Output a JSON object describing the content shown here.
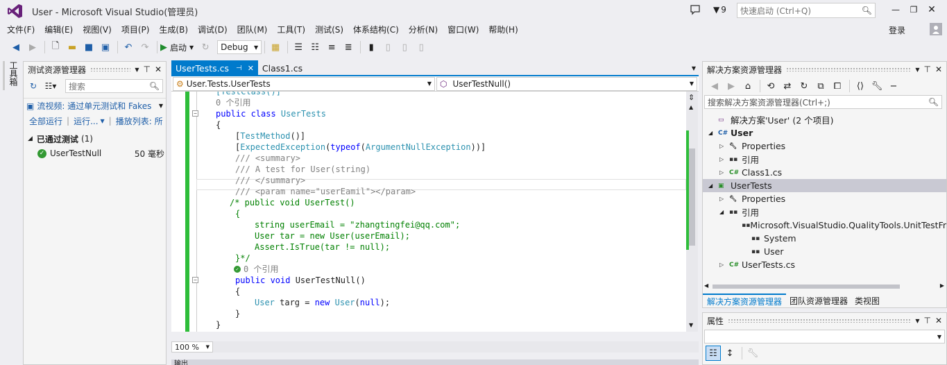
{
  "window": {
    "title": "User - Microsoft Visual Studio(管理员)",
    "notifications": "9",
    "quick_launch_placeholder": "快速启动 (Ctrl+Q)",
    "login": "登录"
  },
  "menu": [
    "文件(F)",
    "编辑(E)",
    "视图(V)",
    "项目(P)",
    "生成(B)",
    "调试(D)",
    "团队(M)",
    "工具(T)",
    "测试(S)",
    "体系结构(C)",
    "分析(N)",
    "窗口(W)",
    "帮助(H)"
  ],
  "toolbar": {
    "start_label": "启动",
    "config": "Debug"
  },
  "toolbox_tab": "工具箱",
  "test_explorer": {
    "title": "测试资源管理器",
    "search_placeholder": "搜索",
    "video_link": "流视频: 通过单元测试和 Fakes",
    "run_all": "全部运行",
    "run": "运行...",
    "playlist": "播放列表: 所",
    "group_label": "已通过测试",
    "group_count": "(1)",
    "tests": [
      {
        "name": "UserTestNull",
        "duration": "50 毫秒"
      }
    ]
  },
  "editor": {
    "tabs": [
      {
        "label": "UserTests.cs",
        "pin": "⊣",
        "active": true
      },
      {
        "label": "Class1.cs",
        "active": false
      }
    ],
    "nav_class": "User.Tests.UserTests",
    "nav_member": "UserTestNull()",
    "zoom": "100 %",
    "lines": [
      {
        "t": "[TestClass()]"
      },
      {
        "t": "0 个引用"
      },
      {
        "t": "public class UserTests"
      },
      {
        "t": "{"
      },
      {
        "t": "[TestMethod()]"
      },
      {
        "t": "[ExpectedException(typeof(ArgumentNullException))]"
      },
      {
        "t": "/// <summary>"
      },
      {
        "t": "/// A test for User(string)"
      },
      {
        "t": "/// </summary>"
      },
      {
        "t": "/// <param name=\"userEamil\"></param>"
      },
      {
        "t": "/* public void UserTest()"
      },
      {
        "t": "{"
      },
      {
        "t": "string userEmail = \"zhangtingfei@qq.com\";"
      },
      {
        "t": "User tar = new User(userEmail);"
      },
      {
        "t": "Assert.IsTrue(tar != null);"
      },
      {
        "t": "}*/"
      },
      {
        "t": "0 个引用"
      },
      {
        "t": "public void UserTestNull()"
      },
      {
        "t": "{"
      },
      {
        "t": "User targ = new User(null);"
      },
      {
        "t": "}"
      },
      {
        "t": "}"
      },
      {
        "t": "}"
      }
    ],
    "output_title": "输出"
  },
  "solution_explorer": {
    "title": "解决方案资源管理器",
    "search_placeholder": "搜索解决方案资源管理器(Ctrl+;)",
    "tree": [
      {
        "label": "解决方案'User' (2 个项目)"
      },
      {
        "label": "User"
      },
      {
        "label": "Properties"
      },
      {
        "label": "引用"
      },
      {
        "label": "Class1.cs"
      },
      {
        "label": "UserTests"
      },
      {
        "label": "Properties"
      },
      {
        "label": "引用"
      },
      {
        "label": "Microsoft.VisualStudio.QualityTools.UnitTestFr"
      },
      {
        "label": "System"
      },
      {
        "label": "User"
      },
      {
        "label": "UserTests.cs"
      }
    ],
    "bottom_tabs": [
      "解决方案资源管理器",
      "团队资源管理器",
      "类视图"
    ]
  },
  "properties": {
    "title": "属性"
  },
  "colors": {
    "accent": "#007acc",
    "vs_purple": "#68217a",
    "green": "#2ebd3a",
    "selection": "#c9c9d3"
  }
}
